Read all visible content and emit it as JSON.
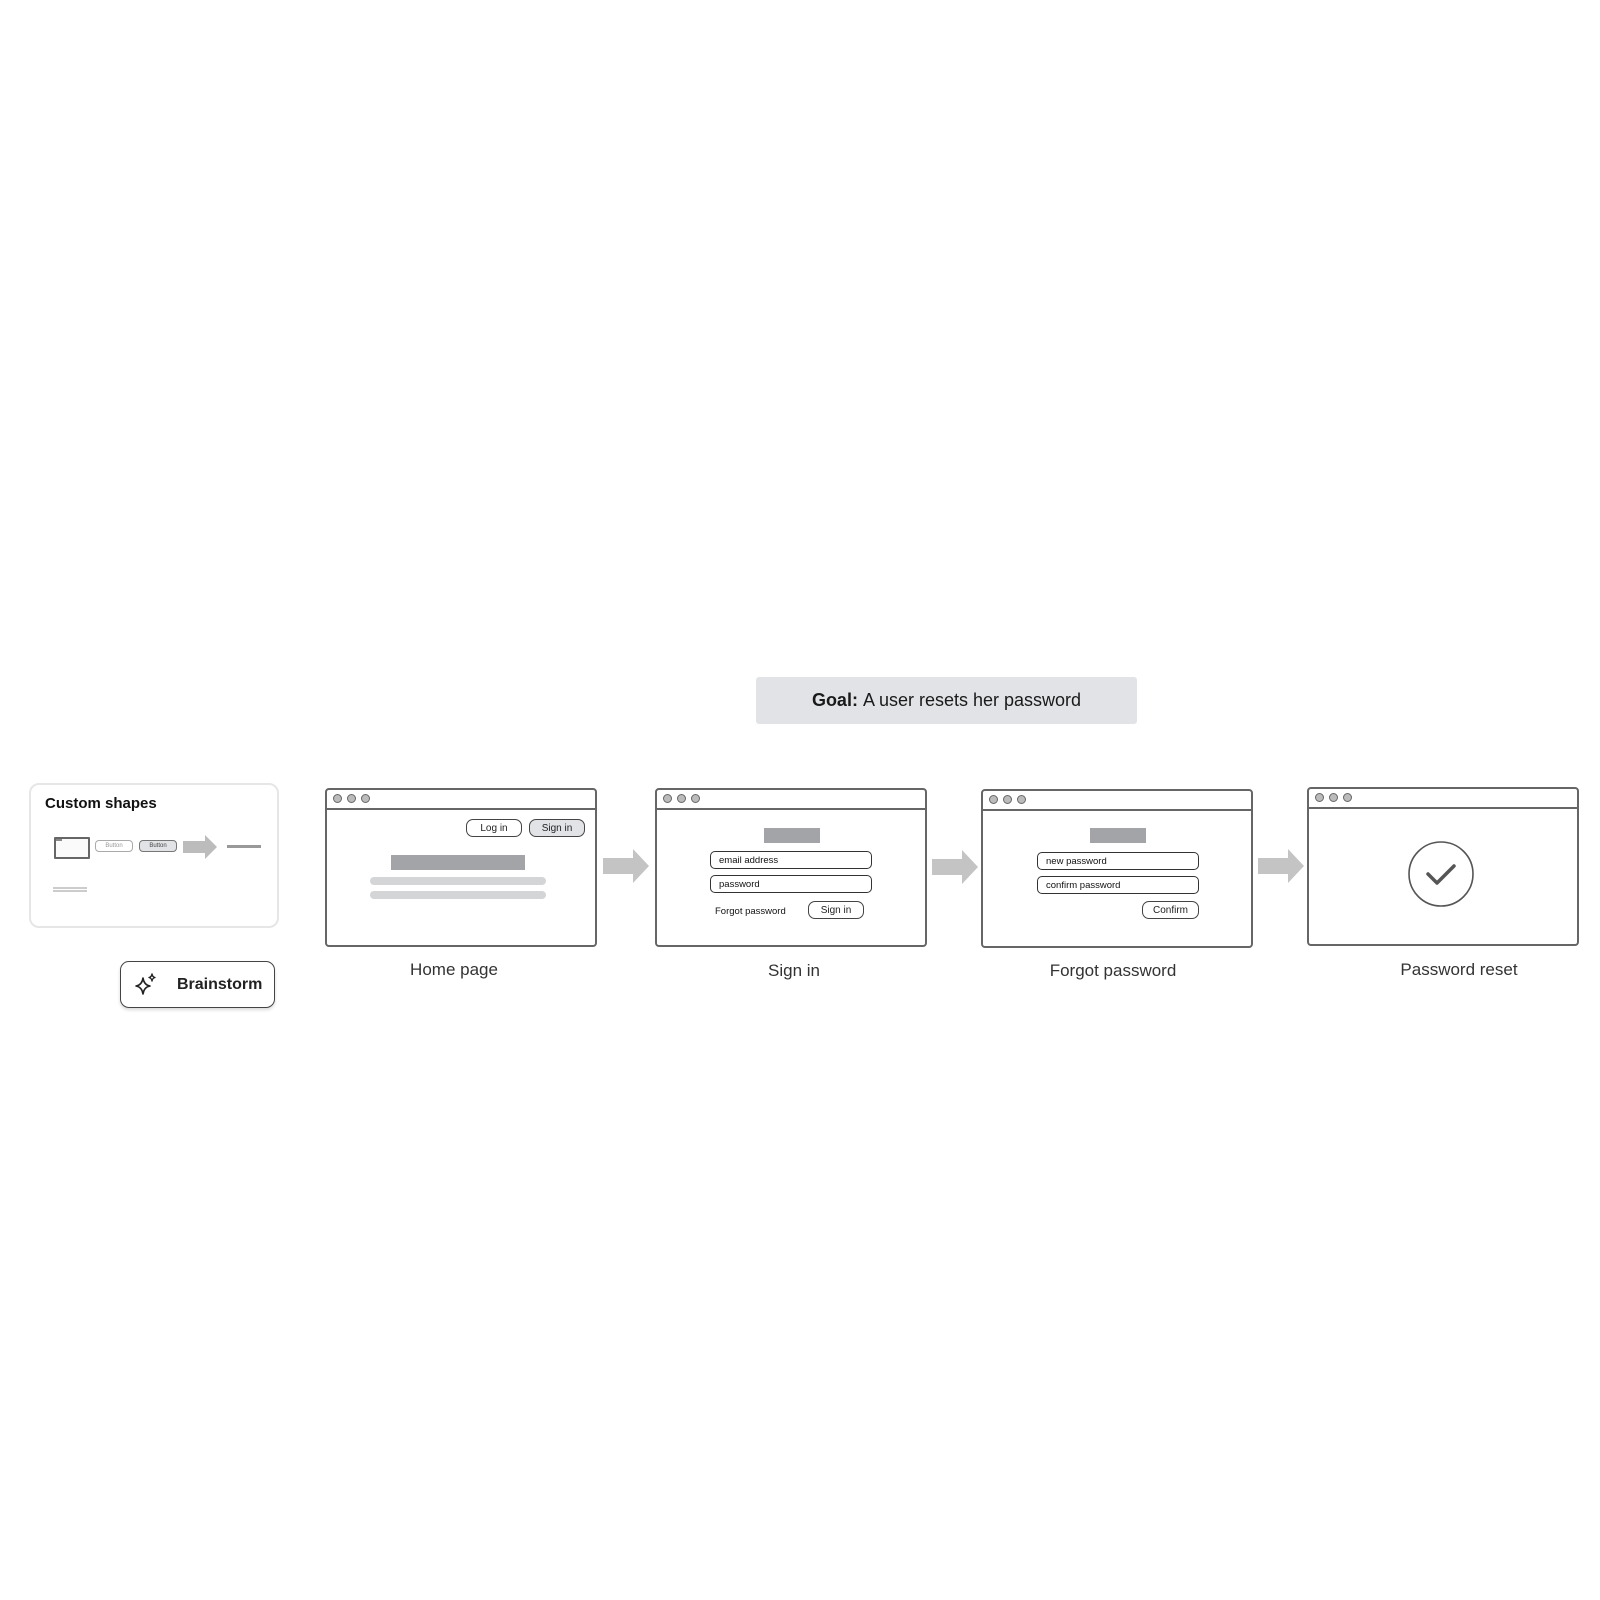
{
  "goal": {
    "label": "Goal:",
    "text": "A user resets her password"
  },
  "custom_shapes": {
    "title": "Custom shapes",
    "button_outline_label": "Button",
    "button_filled_label": "Button"
  },
  "brainstorm": {
    "label": "Brainstorm",
    "icon": "sparkle-icon"
  },
  "colors": {
    "frame_stroke": "#666666",
    "arrow_fill": "#c4c4c4",
    "goal_bg": "#e1e3e6",
    "placeholder_block": "#a3a4a7"
  },
  "screens": [
    {
      "caption": "Home page",
      "buttons": [
        "Log in",
        "Sign in"
      ]
    },
    {
      "caption": "Sign in",
      "fields": [
        "email address",
        "password"
      ],
      "link": "Forgot password",
      "button": "Sign in"
    },
    {
      "caption": "Forgot password",
      "fields": [
        "new password",
        "confirm password"
      ],
      "button": "Confirm"
    },
    {
      "caption": "Password reset",
      "icon": "checkmark-circle-icon"
    }
  ]
}
